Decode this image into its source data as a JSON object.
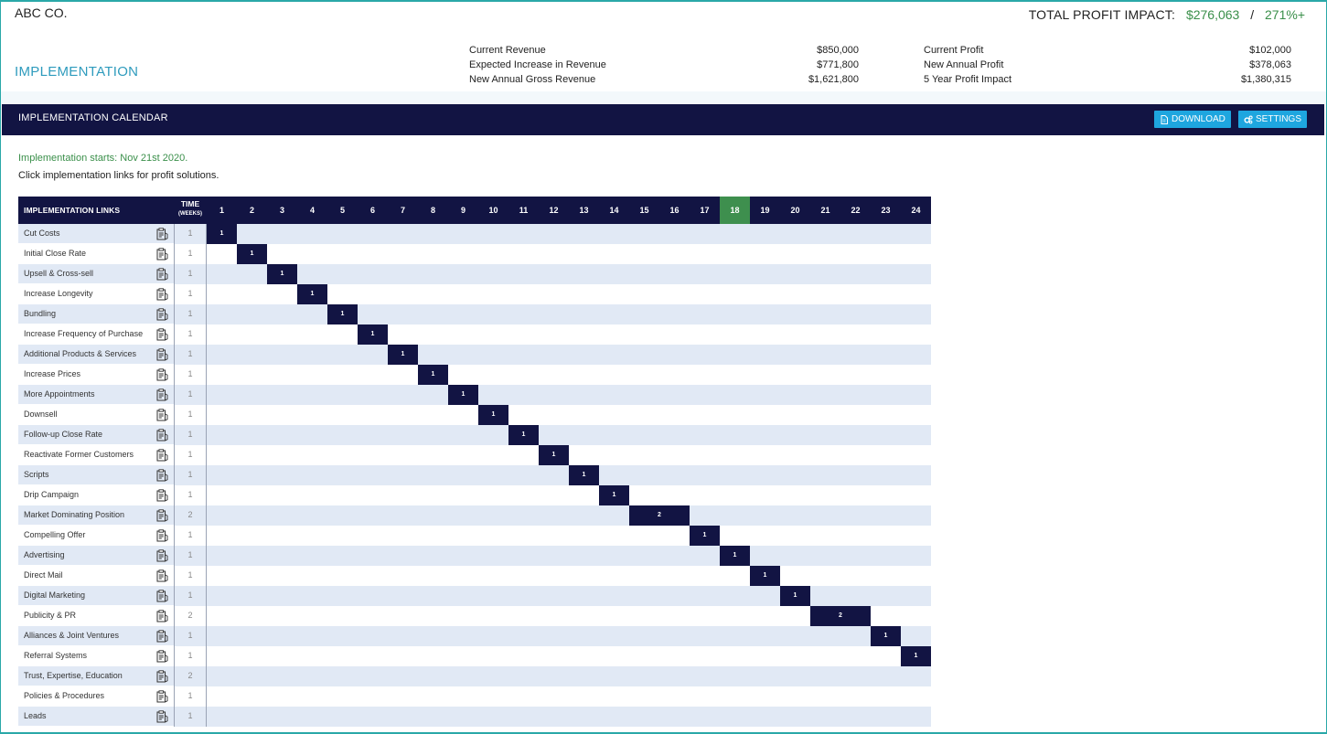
{
  "company": "ABC CO.",
  "impact": {
    "label": "TOTAL PROFIT IMPACT:",
    "value": "$276,063",
    "separator": "/",
    "percent": "271%+"
  },
  "section_title": "IMPLEMENTATION",
  "stats_left": [
    {
      "label": "Current Revenue",
      "value": "$850,000"
    },
    {
      "label": "Expected Increase in Revenue",
      "value": "$771,800"
    },
    {
      "label": "New Annual Gross Revenue",
      "value": "$1,621,800"
    }
  ],
  "stats_right": [
    {
      "label": "Current Profit",
      "value": "$102,000"
    },
    {
      "label": "New Annual Profit",
      "value": "$378,063"
    },
    {
      "label": "5 Year Profit Impact",
      "value": "$1,380,315"
    }
  ],
  "calendar": {
    "title": "IMPLEMENTATION CALENDAR",
    "download_label": "DOWNLOAD",
    "settings_label": "SETTINGS",
    "starts": "Implementation starts: Nov 21st 2020.",
    "instructions": "Click implementation links for profit solutions.",
    "links_header": "IMPLEMENTATION LINKS",
    "time_header": "TIME",
    "time_sub": "(WEEKS)",
    "current_week": 18,
    "weeks": [
      "1",
      "2",
      "3",
      "4",
      "5",
      "6",
      "7",
      "8",
      "9",
      "10",
      "11",
      "12",
      "13",
      "14",
      "15",
      "16",
      "17",
      "18",
      "19",
      "20",
      "21",
      "22",
      "23",
      "24"
    ],
    "rows": [
      {
        "name": "Cut Costs",
        "weeks": 1,
        "start": 1
      },
      {
        "name": "Initial Close Rate",
        "weeks": 1,
        "start": 2
      },
      {
        "name": "Upsell & Cross-sell",
        "weeks": 1,
        "start": 3
      },
      {
        "name": "Increase Longevity",
        "weeks": 1,
        "start": 4
      },
      {
        "name": "Bundling",
        "weeks": 1,
        "start": 5
      },
      {
        "name": "Increase Frequency of Purchase",
        "weeks": 1,
        "start": 6
      },
      {
        "name": "Additional Products & Services",
        "weeks": 1,
        "start": 7
      },
      {
        "name": "Increase Prices",
        "weeks": 1,
        "start": 8
      },
      {
        "name": "More Appointments",
        "weeks": 1,
        "start": 9
      },
      {
        "name": "Downsell",
        "weeks": 1,
        "start": 10
      },
      {
        "name": "Follow-up Close Rate",
        "weeks": 1,
        "start": 11
      },
      {
        "name": "Reactivate Former Customers",
        "weeks": 1,
        "start": 12
      },
      {
        "name": "Scripts",
        "weeks": 1,
        "start": 13
      },
      {
        "name": "Drip Campaign",
        "weeks": 1,
        "start": 14
      },
      {
        "name": "Market Dominating Position",
        "weeks": 2,
        "start": 15
      },
      {
        "name": "Compelling Offer",
        "weeks": 1,
        "start": 17
      },
      {
        "name": "Advertising",
        "weeks": 1,
        "start": 18
      },
      {
        "name": "Direct Mail",
        "weeks": 1,
        "start": 19
      },
      {
        "name": "Digital Marketing",
        "weeks": 1,
        "start": 20
      },
      {
        "name": "Publicity & PR",
        "weeks": 2,
        "start": 21
      },
      {
        "name": "Alliances & Joint Ventures",
        "weeks": 1,
        "start": 23
      },
      {
        "name": "Referral Systems",
        "weeks": 1,
        "start": 24
      },
      {
        "name": "Trust, Expertise, Education",
        "weeks": 2,
        "start": null
      },
      {
        "name": "Policies & Procedures",
        "weeks": 1,
        "start": null
      },
      {
        "name": "Leads",
        "weeks": 1,
        "start": null
      }
    ]
  },
  "colors": {
    "navy": "#121443",
    "green": "#3e8f4e",
    "blue": "#1ea6df",
    "row_alt": "#e1e9f5"
  },
  "icons": {
    "row_action": "clipboard-icon",
    "download": "file-icon",
    "settings": "gears-icon"
  }
}
